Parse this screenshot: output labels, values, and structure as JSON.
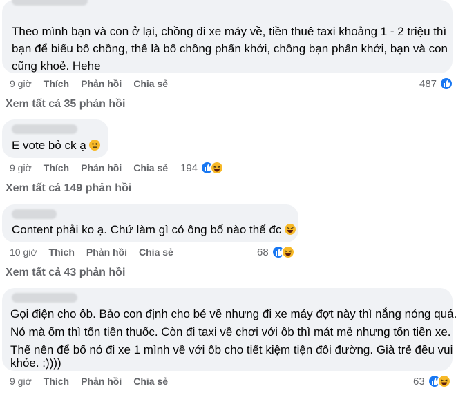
{
  "actions": {
    "like": "Thích",
    "reply": "Phản hồi",
    "share": "Chia sẻ"
  },
  "comments": [
    {
      "lines": [
        "Theo mình bạn và con ở lại, chồng đi xe máy về, tiền thuê taxi khoảng 1 - 2 triệu thì",
        "bạn để biếu bố chồng, thế là bố chồng phấn khởi, chồng bạn phấn khởi, bạn và con",
        "cũng khoẻ. Hehe"
      ],
      "time": "9 giờ",
      "reaction_count": "487",
      "reactions": [
        "like-icon"
      ],
      "view_more": "Xem tất cả 35 phản hồi"
    },
    {
      "lines": [
        "E vote bỏ ck ạ"
      ],
      "inline_emoji": "neutral-face-emoji",
      "time": "9 giờ",
      "reaction_count": "194",
      "reactions": [
        "like-icon",
        "haha-icon"
      ],
      "view_more": "Xem tất cả 149 phản hồi"
    },
    {
      "lines": [
        "Content phải ko ạ. Chứ làm gì có ông bố nào thế đc"
      ],
      "inline_emoji": "laughing-face-emoji",
      "time": "10 giờ",
      "reaction_count": "68",
      "reactions": [
        "like-icon",
        "haha-icon"
      ],
      "view_more": "Xem tất cả 43 phản hồi"
    },
    {
      "lines": [
        "Gọi điện cho ôb. Bảo con định cho bé về nhưng đi xe máy đợt này thì nắng nóng quá.",
        "Nó mà ốm thì tốn tiền thuốc. Còn đi taxi về chơi với ôb thì mát mẻ nhưng tốn tiền xe.",
        "Thế nên để bố nó đi xe 1 mình về với ôb cho tiết kiệm tiện đôi đường. Già trẻ đều vui",
        "khỏe. :))))"
      ],
      "time": "9 giờ",
      "reaction_count": "63",
      "reactions": [
        "like-icon",
        "haha-icon"
      ]
    }
  ],
  "colors": {
    "bubble": "#f0f2f5",
    "secondary_text": "#65676b",
    "like": "#1877f2",
    "haha": "#f7b928"
  }
}
